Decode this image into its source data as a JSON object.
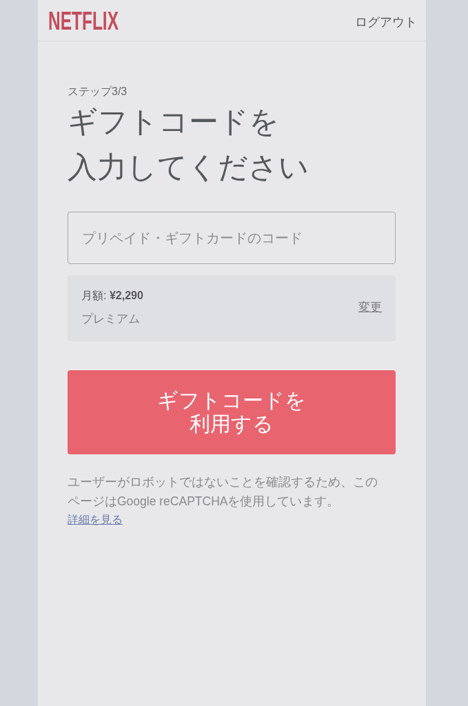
{
  "header": {
    "logo": "NETFLIX",
    "logout_link": "ログアウト"
  },
  "step": "ステップ3/3",
  "heading_lines": [
    "ギフトコードを",
    "入力してください"
  ],
  "code_field": {
    "placeholder": "プリペイド・ギフトカードのコード"
  },
  "plan": {
    "price": "月額: **¥2,290**",
    "name": "プレミアム",
    "change_link": "変更"
  },
  "redeem_button": {
    "lines": [
      "ギフトコードを",
      "利用する"
    ]
  },
  "recaptcha_notice": "ユーザーがロボットではないことを確認するため、このページはGoogle reCAPTCHAを使用しています。",
  "learn_more_link": "詳細を見る"
}
